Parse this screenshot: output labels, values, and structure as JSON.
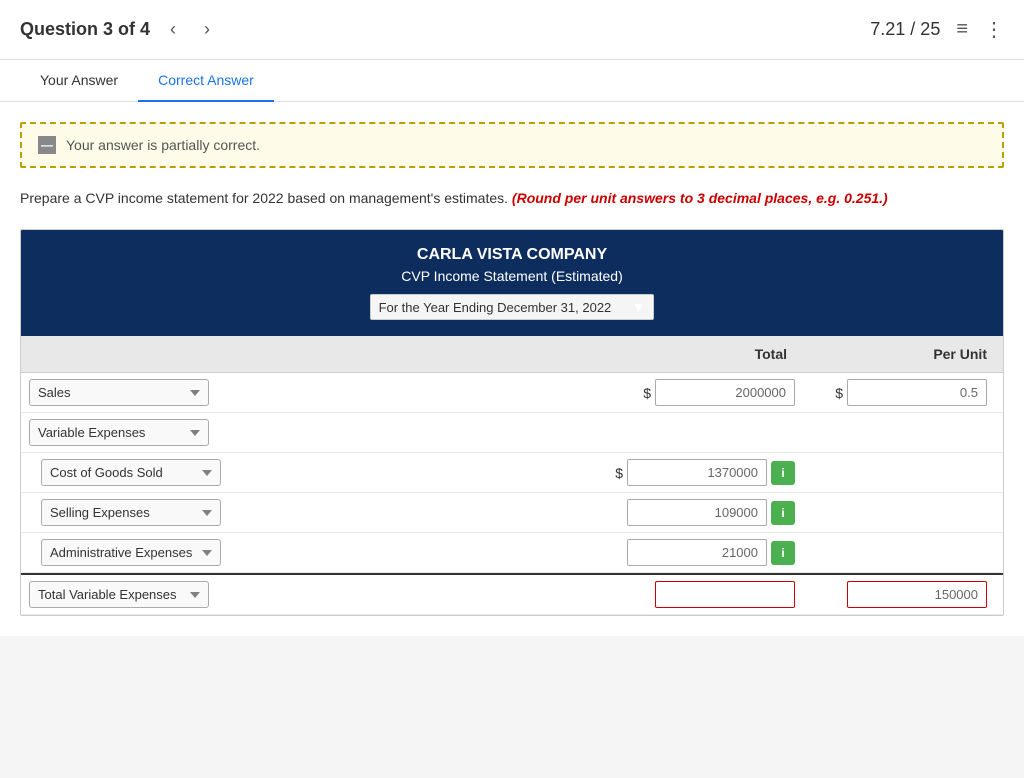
{
  "header": {
    "question_label": "Question 3 of 4",
    "score": "7.21 / 25",
    "prev_icon": "‹",
    "next_icon": "›"
  },
  "tabs": [
    {
      "id": "your-answer",
      "label": "Your Answer",
      "active": false
    },
    {
      "id": "correct-answer",
      "label": "Correct Answer",
      "active": true
    }
  ],
  "banner": {
    "text": "Your answer is partially correct."
  },
  "instruction": {
    "main": "Prepare a CVP income statement for 2022 based on management's estimates.",
    "highlight": "(Round per unit answers to 3 decimal places, e.g. 0.251.)"
  },
  "table": {
    "company": "CARLA VISTA COMPANY",
    "statement": "CVP Income Statement (Estimated)",
    "date_option": "For the Year Ending December 31, 2022",
    "col_total": "Total",
    "col_per_unit": "Per Unit",
    "rows": [
      {
        "type": "main",
        "label": "Sales",
        "dollar_total": "$",
        "value_total": "2000000",
        "dollar_unit": "$",
        "value_unit": "0.5"
      },
      {
        "type": "group-header",
        "label": "Variable Expenses"
      },
      {
        "type": "sub",
        "label": "Cost of Goods Sold",
        "dollar": "$",
        "value_total": "1370000",
        "has_info": true
      },
      {
        "type": "sub",
        "label": "Selling Expenses",
        "value_total": "109000",
        "has_info": true
      },
      {
        "type": "sub",
        "label": "Administrative Expenses",
        "value_total": "21000",
        "has_info": true
      },
      {
        "type": "total",
        "label": "Total Variable Expenses",
        "value_total": "",
        "value_unit": "150000",
        "is_error": true
      }
    ]
  }
}
